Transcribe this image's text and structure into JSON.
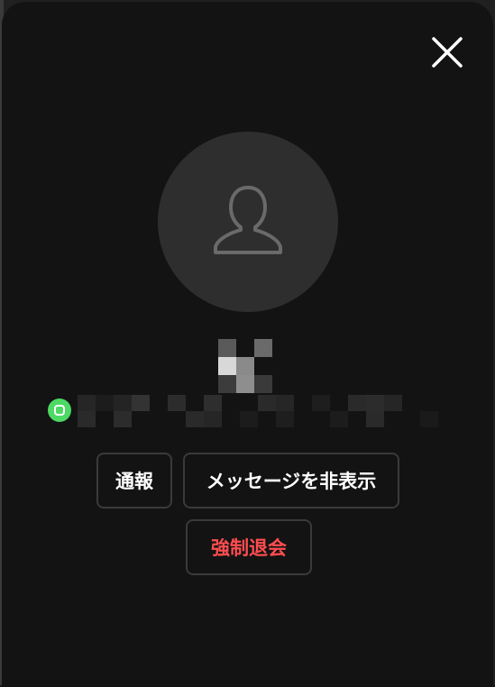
{
  "modal": {
    "close_icon": "close-icon",
    "avatar_icon": "user-silhouette-icon",
    "service_icon": "chat-service-icon",
    "colors": {
      "background": "#131313",
      "button_border": "#3a3a3a",
      "danger": "#ff4d4f",
      "service_green": "#4cd964"
    }
  },
  "actions": {
    "report_label": "通報",
    "hide_messages_label": "メッセージを非表示",
    "force_leave_label": "強制退会"
  }
}
